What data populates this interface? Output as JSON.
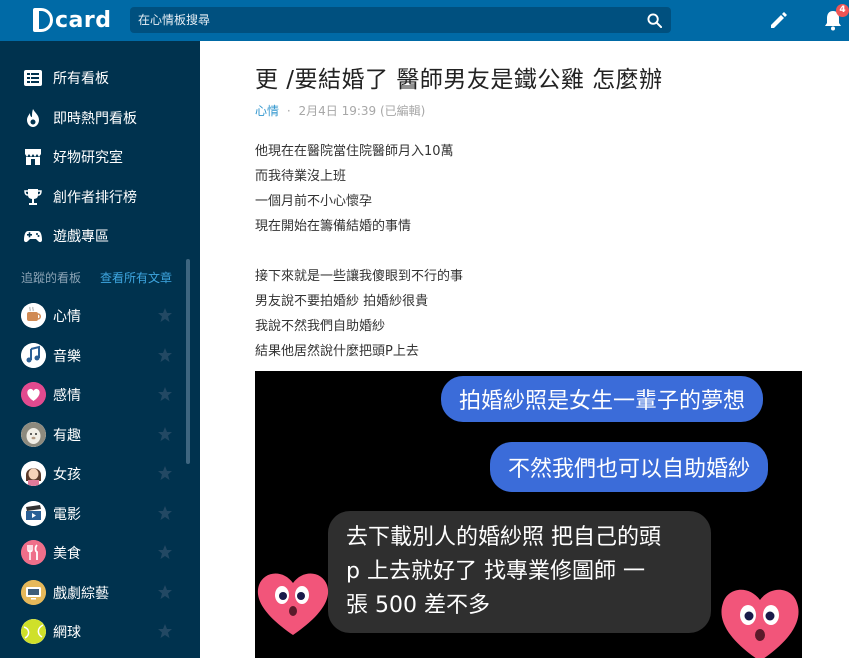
{
  "header": {
    "logo": "card",
    "search_placeholder": "在心情板搜尋",
    "notification_count": "4"
  },
  "sidebar": {
    "nav": [
      {
        "label": "所有看板",
        "icon": "list-icon"
      },
      {
        "label": "即時熱門看板",
        "icon": "fire-icon"
      },
      {
        "label": "好物研究室",
        "icon": "shop-icon"
      },
      {
        "label": "創作者排行榜",
        "icon": "trophy-icon"
      },
      {
        "label": "遊戲專區",
        "icon": "gamepad-icon"
      }
    ],
    "section_title": "追蹤的看板",
    "section_link": "查看所有文章",
    "boards": [
      {
        "label": "心情",
        "icon": "mood-icon"
      },
      {
        "label": "音樂",
        "icon": "music-icon"
      },
      {
        "label": "感情",
        "icon": "heart-icon"
      },
      {
        "label": "有趣",
        "icon": "alpaca-icon"
      },
      {
        "label": "女孩",
        "icon": "girl-icon"
      },
      {
        "label": "電影",
        "icon": "clapper-icon"
      },
      {
        "label": "美食",
        "icon": "cutlery-icon"
      },
      {
        "label": "戲劇綜藝",
        "icon": "tv-icon"
      },
      {
        "label": "網球",
        "icon": "tennis-icon"
      }
    ]
  },
  "post": {
    "title": "更 /要結婚了 醫師男友是鐵公雞 怎麼辦",
    "forum": "心情",
    "separator": "·",
    "date": "2月4日 19:39 (已編輯)",
    "lines": [
      "他現在在醫院當住院醫師月入10萬",
      "而我待業沒上班",
      "一個月前不小心懷孕",
      "現在開始在籌備結婚的事情",
      "",
      "接下來就是一些讓我傻眼到不行的事",
      "男友說不要拍婚紗 拍婚紗很貴",
      "我說不然我們自助婚紗",
      "結果他居然說什麼把頭P上去"
    ],
    "chat": {
      "msg1": "拍婚紗照是女生一輩子的夢想",
      "msg2": "不然我們也可以自助婚紗",
      "msg3_line1": "去下載別人的婚紗照 把自己的頭",
      "msg3_line2": "p 上去就好了 找專業修圖師 一",
      "msg3_line3": "張 500 差不多"
    }
  },
  "colors": {
    "header": "#006aa6",
    "sidebar": "#00324e",
    "accent": "#3397cf",
    "bubble_blue": "#3b6cd9",
    "bubble_grey": "#2f2f2f"
  }
}
